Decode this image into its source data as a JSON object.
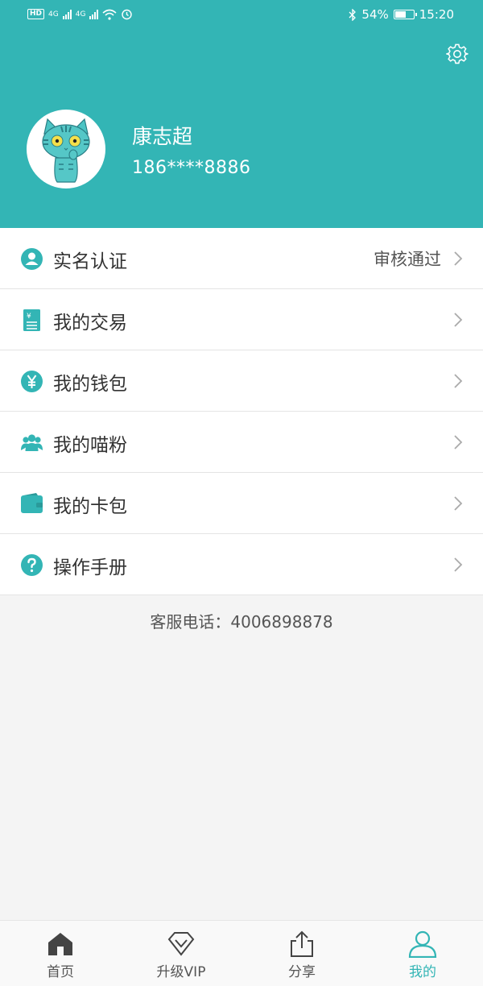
{
  "status_bar": {
    "hd": "HD",
    "net1": "4G",
    "net2": "4G",
    "battery_pct": "54%",
    "battery_level": 0.54,
    "time": "15:20"
  },
  "profile": {
    "name": "康志超",
    "phone": "186****8886",
    "avatar_icon": "cat-avatar-icon",
    "settings_icon": "gear-icon"
  },
  "menu": [
    {
      "label": "实名认证",
      "value": "审核通过",
      "icon": "user-circle-icon"
    },
    {
      "label": "我的交易",
      "value": "",
      "icon": "receipt-icon"
    },
    {
      "label": "我的钱包",
      "value": "",
      "icon": "yen-coin-icon"
    },
    {
      "label": "我的喵粉",
      "value": "",
      "icon": "group-icon"
    },
    {
      "label": "我的卡包",
      "value": "",
      "icon": "wallet-icon"
    },
    {
      "label": "操作手册",
      "value": "",
      "icon": "help-icon"
    }
  ],
  "service": {
    "text": "客服电话：4006898878"
  },
  "tabbar": {
    "tabs": [
      {
        "label": "首页",
        "icon": "home-icon",
        "active": false
      },
      {
        "label": "升级VIP",
        "icon": "diamond-icon",
        "active": false
      },
      {
        "label": "分享",
        "icon": "share-icon",
        "active": false
      },
      {
        "label": "我的",
        "icon": "person-icon",
        "active": true
      }
    ]
  },
  "colors": {
    "accent": "#33b5b5",
    "background": "#f4f4f4",
    "text": "#333333"
  }
}
